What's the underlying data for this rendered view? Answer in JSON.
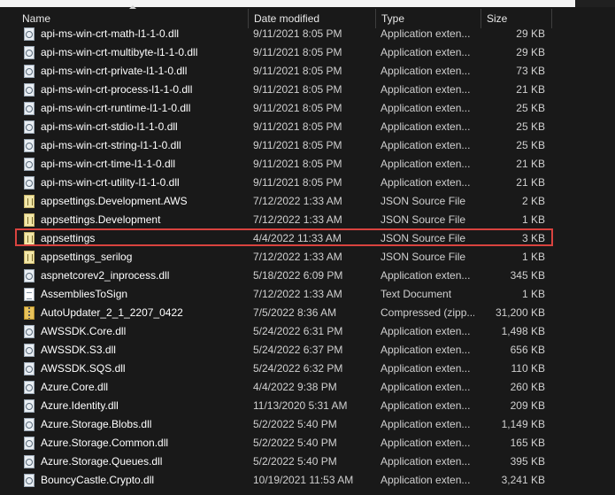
{
  "columns": {
    "name": "Name",
    "date": "Date modified",
    "type": "Type",
    "size": "Size"
  },
  "highlight_color": "#d9433f",
  "files": [
    {
      "name": "api-ms-win-crt-math-l1-1-0.dll",
      "date": "9/11/2021 8:05 PM",
      "type": "Application exten...",
      "size": "29 KB",
      "icon": "dll-file-icon"
    },
    {
      "name": "api-ms-win-crt-multibyte-l1-1-0.dll",
      "date": "9/11/2021 8:05 PM",
      "type": "Application exten...",
      "size": "29 KB",
      "icon": "dll-file-icon"
    },
    {
      "name": "api-ms-win-crt-private-l1-1-0.dll",
      "date": "9/11/2021 8:05 PM",
      "type": "Application exten...",
      "size": "73 KB",
      "icon": "dll-file-icon"
    },
    {
      "name": "api-ms-win-crt-process-l1-1-0.dll",
      "date": "9/11/2021 8:05 PM",
      "type": "Application exten...",
      "size": "21 KB",
      "icon": "dll-file-icon"
    },
    {
      "name": "api-ms-win-crt-runtime-l1-1-0.dll",
      "date": "9/11/2021 8:05 PM",
      "type": "Application exten...",
      "size": "25 KB",
      "icon": "dll-file-icon"
    },
    {
      "name": "api-ms-win-crt-stdio-l1-1-0.dll",
      "date": "9/11/2021 8:05 PM",
      "type": "Application exten...",
      "size": "25 KB",
      "icon": "dll-file-icon"
    },
    {
      "name": "api-ms-win-crt-string-l1-1-0.dll",
      "date": "9/11/2021 8:05 PM",
      "type": "Application exten...",
      "size": "25 KB",
      "icon": "dll-file-icon"
    },
    {
      "name": "api-ms-win-crt-time-l1-1-0.dll",
      "date": "9/11/2021 8:05 PM",
      "type": "Application exten...",
      "size": "21 KB",
      "icon": "dll-file-icon"
    },
    {
      "name": "api-ms-win-crt-utility-l1-1-0.dll",
      "date": "9/11/2021 8:05 PM",
      "type": "Application exten...",
      "size": "21 KB",
      "icon": "dll-file-icon"
    },
    {
      "name": "appsettings.Development.AWS",
      "date": "7/12/2022 1:33 AM",
      "type": "JSON Source File",
      "size": "2 KB",
      "icon": "json-file-icon"
    },
    {
      "name": "appsettings.Development",
      "date": "7/12/2022 1:33 AM",
      "type": "JSON Source File",
      "size": "1 KB",
      "icon": "json-file-icon"
    },
    {
      "name": "appsettings",
      "date": "4/4/2022 11:33 AM",
      "type": "JSON Source File",
      "size": "3 KB",
      "icon": "json-file-icon",
      "highlighted": true
    },
    {
      "name": "appsettings_serilog",
      "date": "7/12/2022 1:33 AM",
      "type": "JSON Source File",
      "size": "1 KB",
      "icon": "json-file-icon"
    },
    {
      "name": "aspnetcorev2_inprocess.dll",
      "date": "5/18/2022 6:09 PM",
      "type": "Application exten...",
      "size": "345 KB",
      "icon": "dll-file-icon"
    },
    {
      "name": "AssembliesToSign",
      "date": "7/12/2022 1:33 AM",
      "type": "Text Document",
      "size": "1 KB",
      "icon": "text-file-icon"
    },
    {
      "name": "AutoUpdater_2_1_2207_0422",
      "date": "7/5/2022 8:36 AM",
      "type": "Compressed (zipp...",
      "size": "31,200 KB",
      "icon": "zip-folder-icon"
    },
    {
      "name": "AWSSDK.Core.dll",
      "date": "5/24/2022 6:31 PM",
      "type": "Application exten...",
      "size": "1,498 KB",
      "icon": "dll-file-icon"
    },
    {
      "name": "AWSSDK.S3.dll",
      "date": "5/24/2022 6:37 PM",
      "type": "Application exten...",
      "size": "656 KB",
      "icon": "dll-file-icon"
    },
    {
      "name": "AWSSDK.SQS.dll",
      "date": "5/24/2022 6:32 PM",
      "type": "Application exten...",
      "size": "110 KB",
      "icon": "dll-file-icon"
    },
    {
      "name": "Azure.Core.dll",
      "date": "4/4/2022 9:38 PM",
      "type": "Application exten...",
      "size": "260 KB",
      "icon": "dll-file-icon"
    },
    {
      "name": "Azure.Identity.dll",
      "date": "11/13/2020 5:31 AM",
      "type": "Application exten...",
      "size": "209 KB",
      "icon": "dll-file-icon"
    },
    {
      "name": "Azure.Storage.Blobs.dll",
      "date": "5/2/2022 5:40 PM",
      "type": "Application exten...",
      "size": "1,149 KB",
      "icon": "dll-file-icon"
    },
    {
      "name": "Azure.Storage.Common.dll",
      "date": "5/2/2022 5:40 PM",
      "type": "Application exten...",
      "size": "165 KB",
      "icon": "dll-file-icon"
    },
    {
      "name": "Azure.Storage.Queues.dll",
      "date": "5/2/2022 5:40 PM",
      "type": "Application exten...",
      "size": "395 KB",
      "icon": "dll-file-icon"
    },
    {
      "name": "BouncyCastle.Crypto.dll",
      "date": "10/19/2021 11:53 AM",
      "type": "Application exten...",
      "size": "3,241 KB",
      "icon": "dll-file-icon"
    }
  ]
}
